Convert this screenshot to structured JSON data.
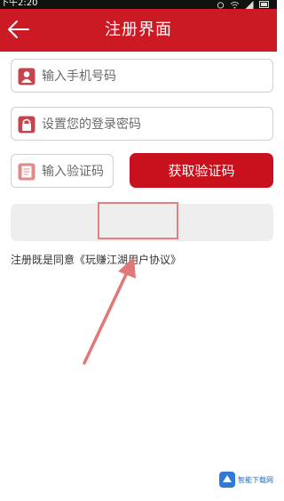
{
  "status_bar": {
    "time": "下午2:20"
  },
  "header": {
    "title": "注册界面"
  },
  "form": {
    "phone_placeholder": "输入手机号码",
    "password_placeholder": "设置您的登录密码",
    "code_placeholder": "输入验证码",
    "get_code_label": "获取验证码",
    "submit_label": ""
  },
  "agreement": {
    "prefix": "注册既是同意",
    "link": "《玩赚江湖用户协议》"
  },
  "watermark": {
    "text": "智能下载网"
  },
  "colors": {
    "header": "#cc1a25",
    "button": "#c8111c",
    "annotation": "#e38080"
  },
  "icons": {
    "back": "back-arrow-icon",
    "phone": "user-icon",
    "password": "lock-icon",
    "code": "document-icon"
  }
}
